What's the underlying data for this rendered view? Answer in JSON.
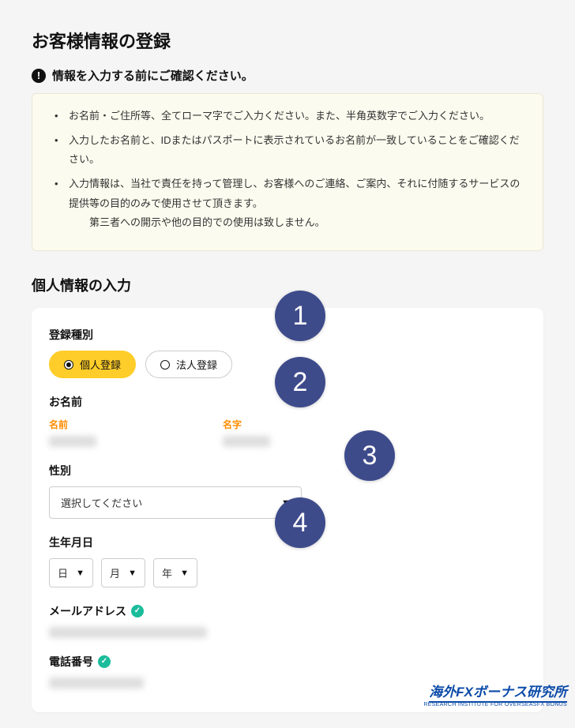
{
  "page_title": "お客様情報の登録",
  "alert_header": "情報を入力する前にご確認ください。",
  "notices": [
    "お名前・ご住所等、全てローマ字でご入力ください。また、半角英数字でご入力ください。",
    "入力したお名前と、IDまたはパスポートに表示されているお名前が一致していることをご確認ください。",
    "入力情報は、当社で責任を持って管理し、お客様へのご連絡、ご案内、それに付随するサービスの提供等の目的のみで使用させて頂きます。"
  ],
  "notice_sub": "第三者への開示や他の目的での使用は致しません。",
  "section_title": "個人情報の入力",
  "fields": {
    "reg_type_label": "登録種別",
    "reg_type_options": {
      "personal": "個人登録",
      "corporate": "法人登録"
    },
    "name_label": "お名前",
    "given_label": "名前",
    "family_label": "名字",
    "gender_label": "性別",
    "gender_placeholder": "選択してください",
    "dob_label": "生年月日",
    "dob_day": "日",
    "dob_month": "月",
    "dob_year": "年",
    "email_label": "メールアドレス",
    "phone_label": "電話番号"
  },
  "badges": {
    "b1": "1",
    "b2": "2",
    "b3": "3",
    "b4": "4"
  },
  "brand": {
    "main": "海外FXボーナス研究所",
    "sub": "RESEARCH INSTITUTE FOR OVERSEASFX BONUS"
  }
}
